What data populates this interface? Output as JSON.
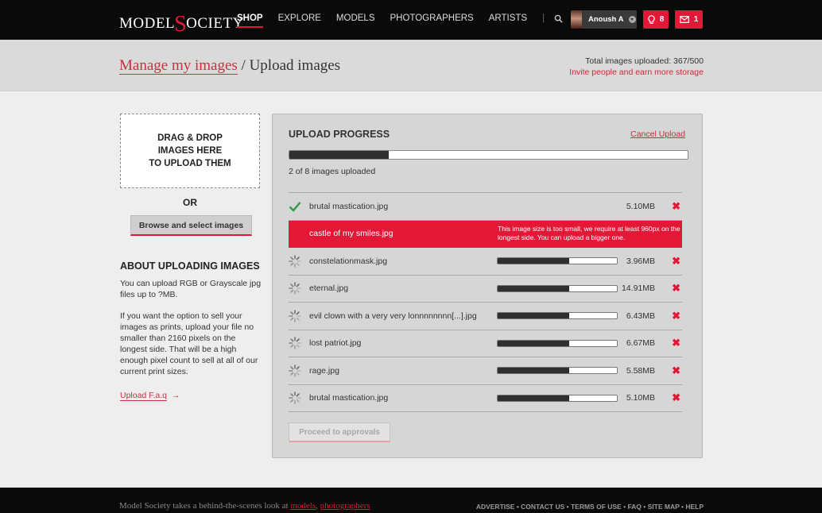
{
  "brand": {
    "part1": "MODEL",
    "s": "S",
    "part2": "OCIETY"
  },
  "nav": [
    {
      "label": "SHOP",
      "active": true
    },
    {
      "label": "EXPLORE",
      "active": false
    },
    {
      "label": "MODELS",
      "active": false
    },
    {
      "label": "PHOTOGRAPHERS",
      "active": false
    },
    {
      "label": "ARTISTS",
      "active": false
    }
  ],
  "nav_sep": "|",
  "user": {
    "name": "Anoush A"
  },
  "badges": {
    "ideas": "8",
    "messages": "1"
  },
  "breadcrumb": {
    "parent": "Manage my images",
    "sep": " / ",
    "current": "Upload images"
  },
  "stats": {
    "total": "Total images uploaded: 367/500",
    "invite": "Invite people and earn more storage"
  },
  "drop": {
    "line1": "DRAG & DROP",
    "line2": "IMAGES HERE",
    "line3": "TO UPLOAD THEM"
  },
  "or": "OR",
  "browse": "Browse and select images",
  "about": {
    "heading": "ABOUT UPLOADING IMAGES",
    "p1": "You can upload RGB or Grayscale jpg files up to ?MB.",
    "p2": "If you want the option to sell your images as prints, upload your file no smaller than 2160 pixels on the longest side. That will be a high enough pixel count to sell at all of our current print sizes.",
    "faq": "Upload F.a.q",
    "arrow": "→"
  },
  "panel": {
    "title": "UPLOAD PROGRESS",
    "cancel": "Cancel Upload",
    "progress": 0.25,
    "count": "2 of 8 images uploaded",
    "proceed": "Proceed to approvals"
  },
  "files": [
    {
      "name": "brutal mastication.jpg",
      "size": "5.10MB",
      "status": "done"
    },
    {
      "name": "castle of my smiles.jpg",
      "status": "error",
      "message": "This image size is too small, we require at least 960px on the longest side. You can upload a bigger one."
    },
    {
      "name": "constelationmask.jpg",
      "size": "3.96MB",
      "status": "uploading",
      "progress": 0.6
    },
    {
      "name": "eternal.jpg",
      "size": "14.91MB",
      "status": "uploading",
      "progress": 0.6
    },
    {
      "name": "evil clown with a very very lonnnnnnnn[...].jpg",
      "size": "6.43MB",
      "status": "uploading",
      "progress": 0.6
    },
    {
      "name": "lost patriot.jpg",
      "size": "6.67MB",
      "status": "uploading",
      "progress": 0.6
    },
    {
      "name": "rage.jpg",
      "size": "5.58MB",
      "status": "uploading",
      "progress": 0.6
    },
    {
      "name": "brutal mastication.jpg",
      "size": "5.10MB",
      "status": "uploading",
      "progress": 0.6
    }
  ],
  "remove_glyph": "✖",
  "footer": {
    "text": "Model Society takes a behind-the-scenes look at ",
    "link1": "models",
    "comma": ", ",
    "link2": "photographers",
    "links": [
      "ADVERTISE",
      "CONTACT US",
      "TERMS OF USE",
      "FAQ",
      "SITE MAP",
      "HELP"
    ],
    "dot": " • "
  },
  "colors": {
    "accent": "#e31837",
    "panel": "#d6d6d6",
    "bar": "#2f2f2f"
  }
}
